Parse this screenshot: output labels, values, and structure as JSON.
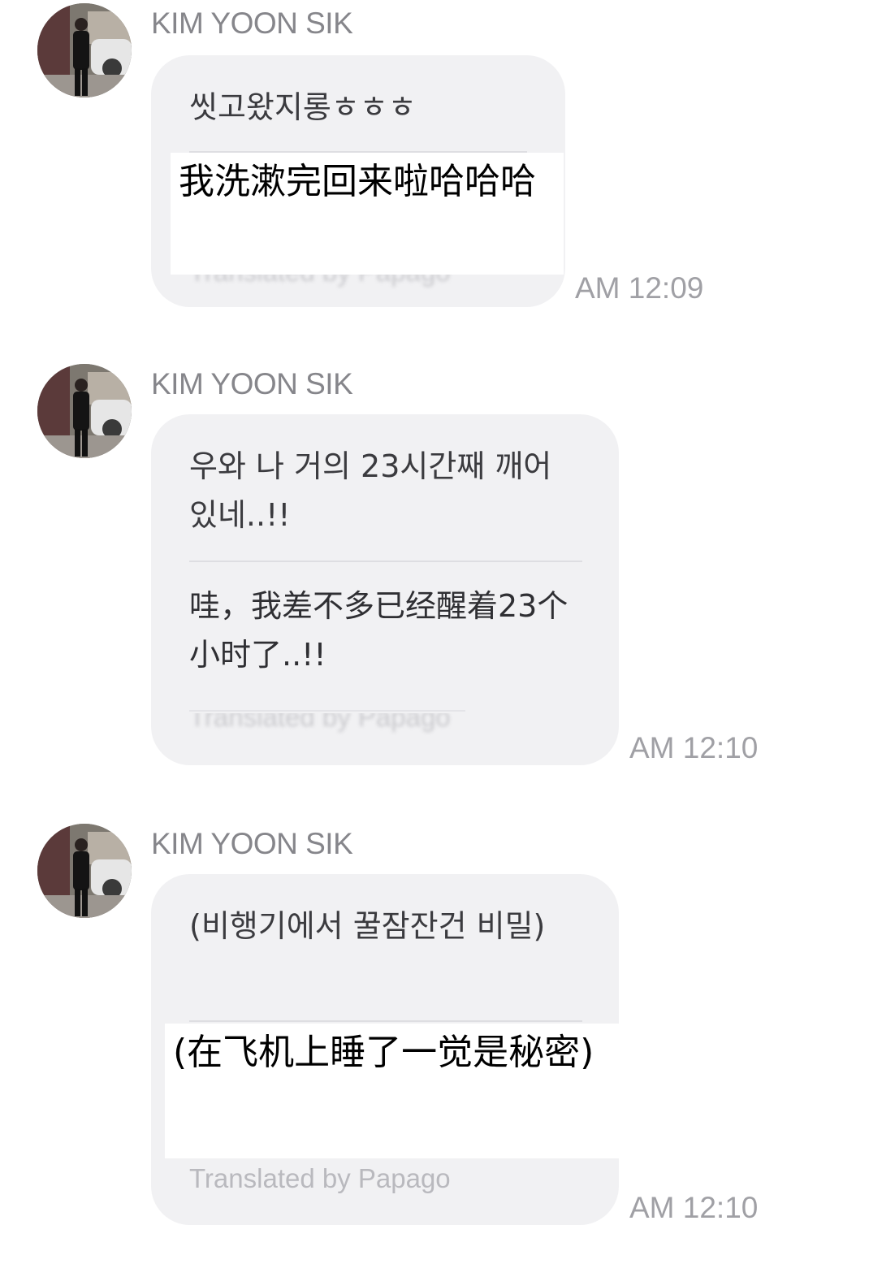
{
  "messages": [
    {
      "sender": "KIM YOON SIK",
      "original": "씻고왔지롱ㅎㅎㅎ",
      "translation_overlay": "我洗漱完回来啦哈哈哈",
      "time": "AM 12:09"
    },
    {
      "sender": "KIM YOON SIK",
      "original": "우와 나 거의 23시간째 깨어있네..!!",
      "translation": "哇，我差不多已经醒着23个小时了..!!",
      "time": "AM 12:10"
    },
    {
      "sender": "KIM YOON SIK",
      "original": "(비행기에서 꿀잠잔건 비밀)",
      "translation_overlay": "(在飞机上睡了一觉是秘密)",
      "footer": "Translated by Papago",
      "time": "AM 12:10"
    }
  ]
}
